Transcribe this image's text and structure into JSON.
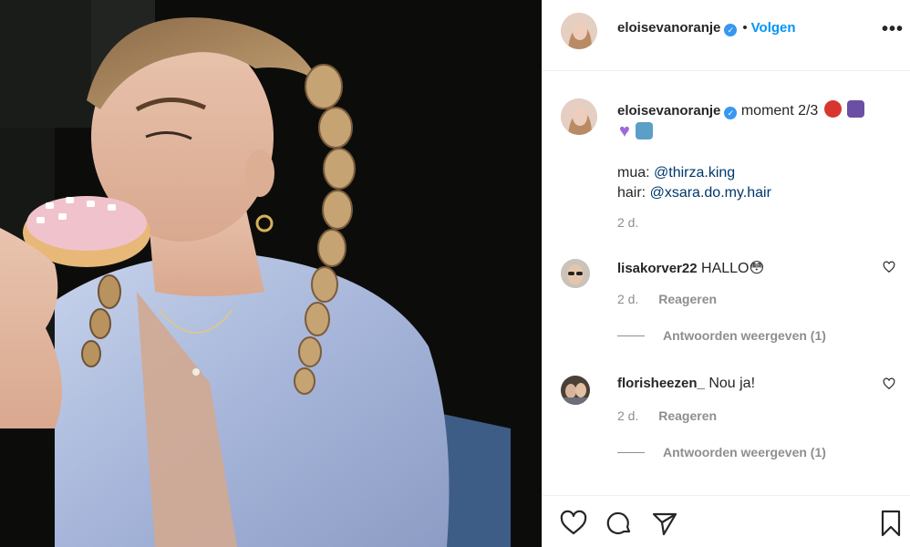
{
  "post": {
    "author": "eloisevanoranje",
    "follow_label": "Volgen",
    "separator": "•",
    "more_label": "•••",
    "verified_mark": "✓"
  },
  "caption": {
    "author": "eloisevanoranje",
    "text": "moment 2/3",
    "mua_label": "mua:",
    "mua_handle": "@thirza.king",
    "hair_label": "hair:",
    "hair_handle": "@xsara.do.my.hair",
    "time": "2 d."
  },
  "comments": [
    {
      "author": "lisakorver22",
      "text": "HALLO😳",
      "time": "2 d.",
      "reply_label": "Reageren",
      "view_replies": "Antwoorden weergeven (1)"
    },
    {
      "author": "florisheezen_",
      "text": "Nou ja!",
      "time": "2 d.",
      "reply_label": "Reageren",
      "view_replies": "Antwoorden weergeven (1)"
    }
  ],
  "icons": {
    "like": "heart-icon",
    "comment": "comment-icon",
    "share": "send-icon",
    "save": "bookmark-icon"
  },
  "colors": {
    "accent": "#0095f6",
    "mention": "#00376b",
    "muted": "#8e8e8e",
    "verified": "#3897f0"
  }
}
